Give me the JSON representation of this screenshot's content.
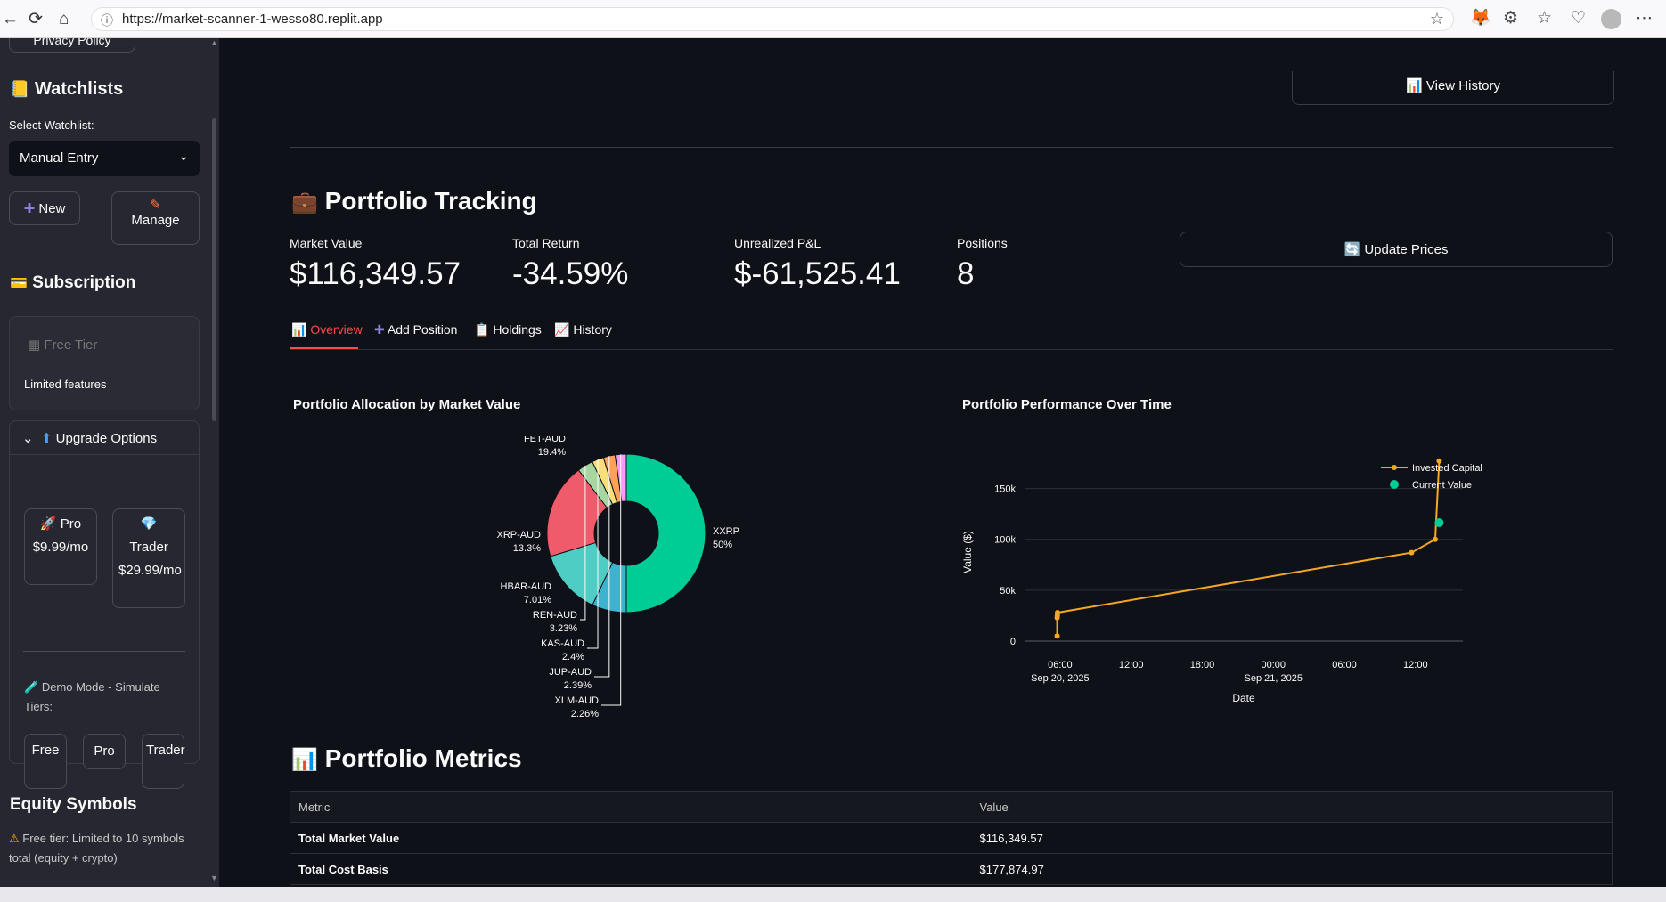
{
  "browser": {
    "url": "https://market-scanner-1-wesso80.replit.app"
  },
  "sidebar": {
    "privacy_button": "Privacy Policy",
    "watchlists_title": "Watchlists",
    "select_label": "Select Watchlist:",
    "select_value": "Manual Entry",
    "new_button": "New",
    "manage_button": "Manage",
    "subscription_title": "Subscription",
    "tier_name": "Free Tier",
    "tier_desc": "Limited features",
    "upgrade_title": "Upgrade Options",
    "pro_button": "Pro $9.99/mo",
    "trader_button": "Trader $29.99/mo",
    "demo_label": "Demo Mode - Simulate Tiers:",
    "demo_free": "Free",
    "demo_pro": "Pro",
    "demo_trader": "Trader",
    "equity_title": "Equity Symbols",
    "equity_note": "Free tier: Limited to 10 symbols total (equity + crypto)"
  },
  "main": {
    "view_history_button": "View History",
    "section_title": "Portfolio Tracking",
    "metrics": [
      {
        "label": "Market Value",
        "value": "$116,349.57"
      },
      {
        "label": "Total Return",
        "value": "-34.59%"
      },
      {
        "label": "Unrealized P&L",
        "value": "$-61,525.41"
      },
      {
        "label": "Positions",
        "value": "8"
      }
    ],
    "update_button": "Update Prices",
    "tabs": [
      "Overview",
      "Add Position",
      "Holdings",
      "History"
    ],
    "metrics_title": "Portfolio Metrics",
    "table": {
      "headers": [
        "Metric",
        "Value"
      ],
      "rows": [
        [
          "Total Market Value",
          "$116,349.57"
        ],
        [
          "Total Cost Basis",
          "$177,874.97"
        ]
      ]
    }
  },
  "colors": {
    "accent": "#ff4b4b",
    "bg": "#0e1117",
    "sidebar": "#262730",
    "line": "#f5a623",
    "teal": "#00cc96"
  },
  "chart_data": [
    {
      "type": "pie",
      "title": "Portfolio Allocation by Market Value",
      "hole": true,
      "slices": [
        {
          "label": "XXRP",
          "percent": "50%",
          "value": 50,
          "color": "#00cc96"
        },
        {
          "label": "HBAR-AUD",
          "percent": "7.01%",
          "value": 7.01,
          "color": "#3eb3cf"
        },
        {
          "label": "XRP-AUD",
          "percent": "13.3%",
          "value": 13.3,
          "color": "#4ecdc4"
        },
        {
          "label": "FET-AUD",
          "percent": "19.4%",
          "value": 19.4,
          "color": "#ef5b6b"
        },
        {
          "label": "REN-AUD",
          "percent": "3.23%",
          "value": 3.23,
          "color": "#a7d6a0"
        },
        {
          "label": "KAS-AUD",
          "percent": "2.4%",
          "value": 2.4,
          "color": "#f7e07a"
        },
        {
          "label": "JUP-AUD",
          "percent": "2.39%",
          "value": 2.39,
          "color": "#ffa15a"
        },
        {
          "label": "XLM-AUD",
          "percent": "2.26%",
          "value": 2.26,
          "color": "#ff97ff"
        }
      ]
    },
    {
      "type": "line",
      "title": "Portfolio Performance Over Time",
      "xlabel": "Date",
      "ylabel": "Value ($)",
      "yticks": [
        "0",
        "50k",
        "100k",
        "150k"
      ],
      "xticks": [
        "06:00\nSep 20, 2025",
        "12:00",
        "18:00",
        "00:00\nSep 21, 2025",
        "06:00",
        "12:00"
      ],
      "ylim": [
        0,
        175000
      ],
      "series": [
        {
          "name": "Invested Capital",
          "color": "#f5a623",
          "points": [
            {
              "x": "2025-09-20 05:45",
              "y": 5000
            },
            {
              "x": "2025-09-20 05:45",
              "y": 23000
            },
            {
              "x": "2025-09-20 05:46",
              "y": 25000
            },
            {
              "x": "2025-09-20 05:47",
              "y": 28000
            },
            {
              "x": "2025-09-21 11:40",
              "y": 87000
            },
            {
              "x": "2025-09-21 13:40",
              "y": 100000
            },
            {
              "x": "2025-09-21 14:00",
              "y": 177000
            }
          ]
        },
        {
          "name": "Current Value",
          "color": "#00cc96",
          "points": [
            {
              "x": "2025-09-21 14:00",
              "y": 116350
            }
          ]
        }
      ]
    }
  ]
}
